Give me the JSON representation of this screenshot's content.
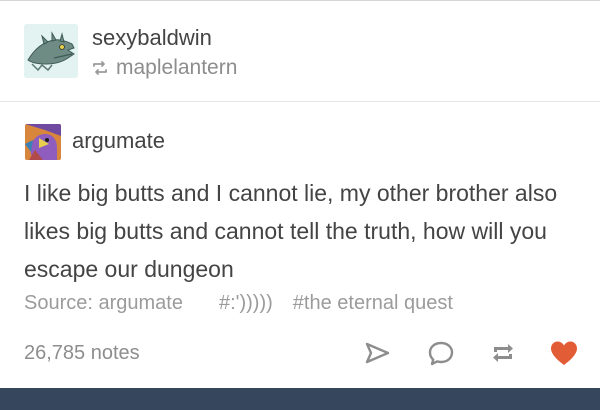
{
  "post": {
    "poster": "sexybaldwin",
    "reblogged_from": "maplelantern",
    "reblog_author": "argumate",
    "body_lines": [
      "I like big butts and I cannot lie, my other brother also",
      "likes big butts and cannot tell the truth, how will you",
      "escape our dungeon"
    ],
    "source_label": "Source: argumate",
    "tags": [
      "#:')))))",
      "#the eternal quest"
    ],
    "notes": "26,785 notes"
  },
  "icons": {
    "poster_avatar": "dragon-avatar-icon",
    "reblog": "reblog-icon",
    "author_avatar": "bird-avatar-icon",
    "send": "paper-plane-icon",
    "reply": "speech-bubble-icon",
    "reblog_action": "reblog-action-icon",
    "like": "heart-icon"
  },
  "colors": {
    "text": "#444444",
    "muted": "#9b9b9b",
    "like": "#e25c35",
    "nav_bar": "#36465d"
  }
}
